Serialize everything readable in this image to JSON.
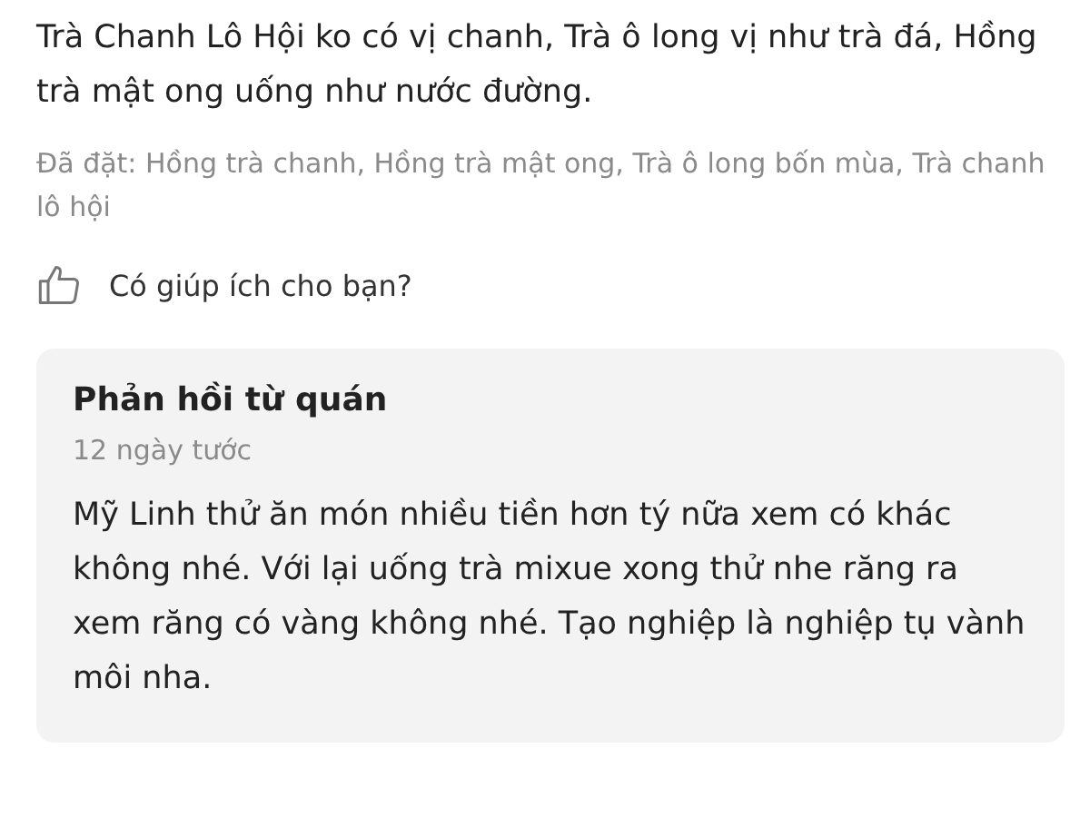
{
  "review": {
    "text": "Trà Chanh Lô Hội ko có vị chanh, Trà ô long vị như trà đá, Hồng trà mật ong uống như nước đường.",
    "ordered": "Đã đặt: Hồng trà chanh, Hồng trà mật ong, Trà ô long bốn mùa, Trà chanh lô hội",
    "helpful": {
      "label": "Có giúp ích cho bạn?",
      "liked": false
    }
  },
  "shop_reply": {
    "title": "Phản hồi từ quán",
    "time": "12 ngày tước",
    "text": "Mỹ Linh thử ăn món nhiều tiền hơn tý nữa xem có khác không nhé. Với lại uống trà mixue xong thử nhe răng ra xem răng có vàng không nhé. Tạo nghiệp là nghiệp tụ vành môi nha."
  }
}
